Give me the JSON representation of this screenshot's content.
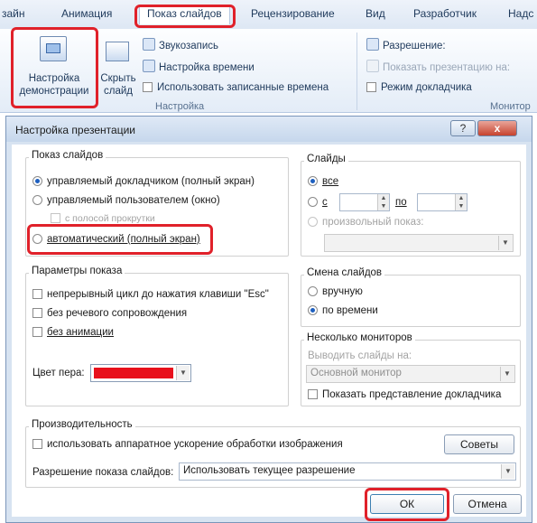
{
  "ribbon": {
    "tabs": [
      "зайн",
      "Анимация",
      "Показ слайдов",
      "Рецензирование",
      "Вид",
      "Разработчик",
      "Надс"
    ],
    "setup_button": "Настройка демонстрации",
    "hide_slide_button": "Скрыть слайд",
    "record_audio": "Звукозапись",
    "rehearse_timings": "Настройка времени",
    "use_timings": "Использовать записанные времена",
    "setup_group": "Настройка",
    "resolution": "Разрешение:",
    "show_on": "Показать презентацию на:",
    "presenter_view": "Режим докладчика",
    "monitors_group": "Монитор"
  },
  "dialog": {
    "title": "Настройка презентации",
    "help_btn": "?",
    "close_btn": "x",
    "show_type": {
      "legend": "Показ слайдов",
      "presenter": "управляемый докладчиком (полный экран)",
      "individual": "управляемый пользователем (окно)",
      "scrollbar": "с полосой прокрутки",
      "kiosk": "автоматический (полный экран)"
    },
    "slides": {
      "legend": "Слайды",
      "all": "все",
      "from": "с",
      "to": "по",
      "from_value": "",
      "to_value": "",
      "custom": "произвольный показ:",
      "custom_value": ""
    },
    "options": {
      "legend": "Параметры показа",
      "loop": "непрерывный цикл до нажатия клавиши \"Esc\"",
      "no_narration": "без речевого сопровождения",
      "no_animation": "без анимации",
      "pen_color_label": "Цвет пера:",
      "pen_color": "#e8101c"
    },
    "advance": {
      "legend": "Смена слайдов",
      "manual": "вручную",
      "timings": "по времени"
    },
    "monitors": {
      "legend": "Несколько мониторов",
      "display_on": "Выводить слайды на:",
      "monitor_value": "Основной монитор",
      "presenter_view": "Показать представление докладчика"
    },
    "performance": {
      "legend": "Производительность",
      "hw_accel": "использовать аппаратное ускорение обработки изображения",
      "tips_btn": "Советы",
      "resolution_label": "Разрешение показа слайдов:",
      "resolution_value": "Использовать текущее разрешение"
    },
    "ok": "ОК",
    "cancel": "Отмена"
  },
  "colors": {
    "highlight": "#e0212a",
    "accent": "#1d5fbf"
  }
}
